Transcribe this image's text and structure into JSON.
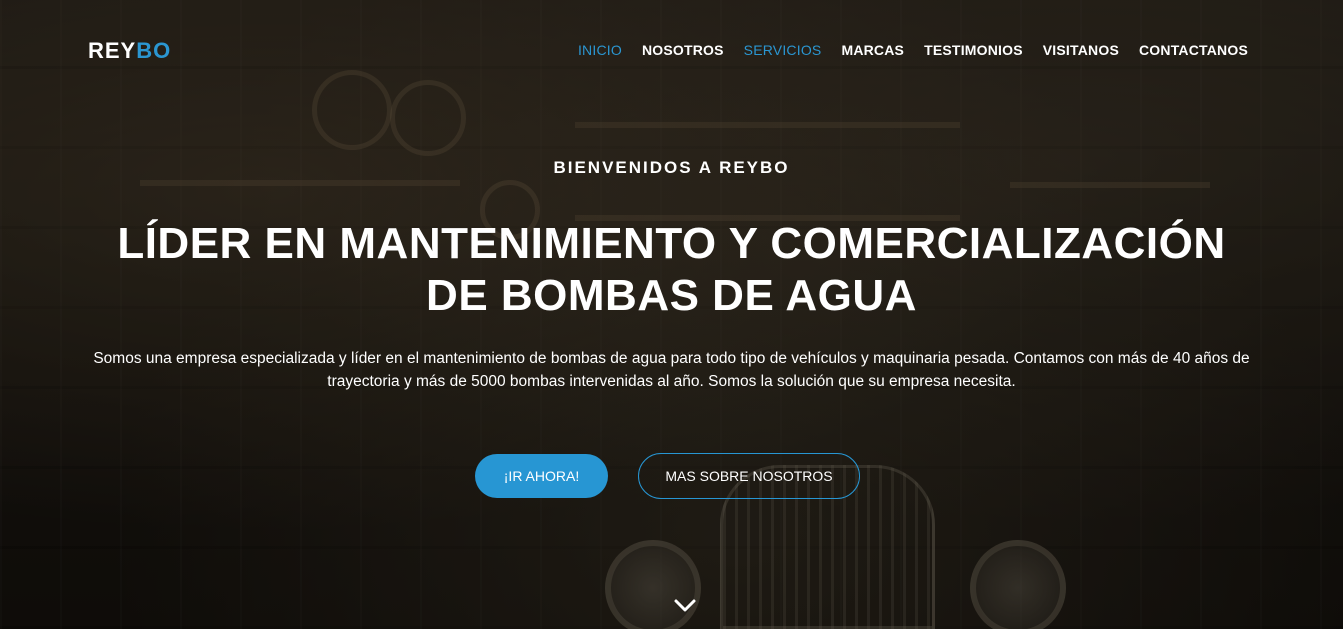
{
  "brand": {
    "logo_main": "REY",
    "logo_accent": "BO"
  },
  "nav": {
    "items": [
      {
        "label": "INICIO"
      },
      {
        "label": "NOSOTROS"
      },
      {
        "label": "SERVICIOS"
      },
      {
        "label": "MARCAS"
      },
      {
        "label": "TESTIMONIOS"
      },
      {
        "label": "VISITANOS"
      },
      {
        "label": "CONTACTANOS"
      }
    ]
  },
  "hero": {
    "welcome": "BIENVENIDOS A REYBO",
    "headline_line1": "LÍDER EN MANTENIMIENTO Y COMERCIALIZACIÓN",
    "headline_line2": "DE BOMBAS DE AGUA",
    "description": "Somos una empresa especializada y líder en el mantenimiento de bombas de agua para todo tipo de vehículos y maquinaria pesada. Contamos con más de 40 años de trayectoria y más de 5000 bombas intervenidas al año. Somos la solución que su empresa necesita.",
    "primary_button": "¡IR AHORA!",
    "secondary_button": "MAS SOBRE NOSOTROS"
  },
  "icons": {
    "scroll": "chevron-down-icon"
  },
  "colors": {
    "accent": "#2b96d1",
    "button": "#2796d3",
    "text": "#ffffff"
  }
}
